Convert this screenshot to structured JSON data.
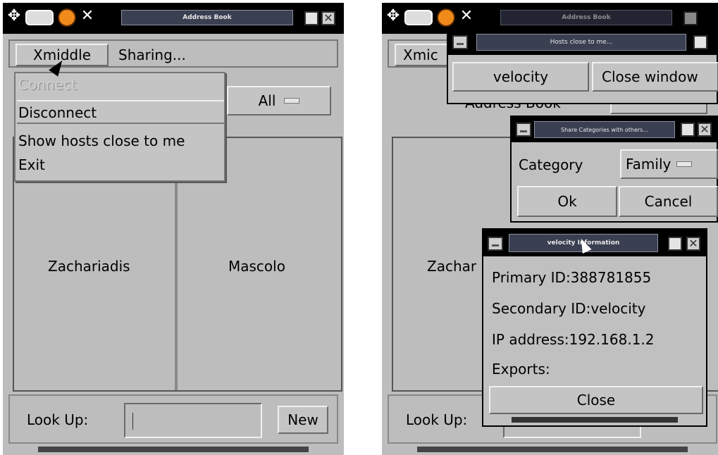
{
  "left": {
    "window_title": "Address Book",
    "menubar": {
      "xmiddle": "Xmiddle",
      "sharing": "Sharing..."
    },
    "menu_items": [
      "Connect",
      "Disconnect",
      "Show hosts close to me",
      "Exit"
    ],
    "filter_selected": "All",
    "cards": [
      "Zachariadis",
      "Mascolo"
    ],
    "lookup_label": "Look Up:",
    "lookup_value": "",
    "new_label": "New"
  },
  "right": {
    "window_title": "Address Book",
    "xmiddle_partial": "Xmic",
    "behind_partial": "Address Book",
    "card_partial": "Zachar",
    "lookup_label": "Look Up:",
    "hosts_dialog": {
      "title": "Hosts close to me...",
      "host_label": "velocity",
      "close_label": "Close window"
    },
    "share_dialog": {
      "title": "Share Categories with others...",
      "category_label": "Category",
      "category_value": "Family",
      "ok_label": "Ok",
      "cancel_label": "Cancel"
    },
    "info_dialog": {
      "title": "velocity Information",
      "primary_id": "Primary ID:388781855",
      "secondary_id": "Secondary ID:velocity",
      "ip": "IP address:192.168.1.2",
      "exports": "Exports:",
      "close_label": "Close"
    }
  },
  "colors": {
    "screen": "#bdbdbd",
    "titlebar": "#000000",
    "title_fill": "#3a3f52"
  },
  "icons": [
    "move-icon",
    "keyboard-icon",
    "face-icon",
    "close-x-icon",
    "maximize-icon",
    "close-icon",
    "minimize-icon",
    "mouse-pointer-icon",
    "text-caret-icon"
  ]
}
